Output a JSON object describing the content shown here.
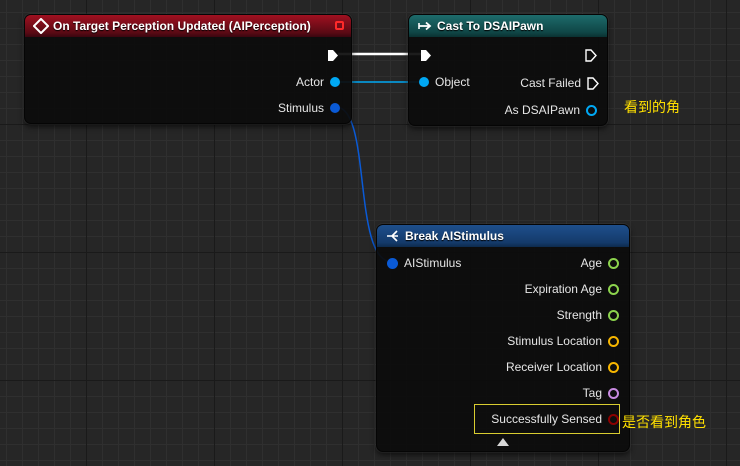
{
  "colors": {
    "object_pin": "#00a8f4",
    "struct_pin": "#0a5ad6",
    "float_pin": "#8cd34d",
    "vector_pin": "#f7b600",
    "name_pin": "#c78ae0",
    "bool_pin": "#8b0000",
    "exec_pin": "#ffffff",
    "annotation": "#ffe000"
  },
  "event_node": {
    "title": "On Target Perception Updated (AIPerception)",
    "icon": "event-diamond-icon",
    "pins": {
      "actor": "Actor",
      "stimulus": "Stimulus"
    }
  },
  "cast_node": {
    "title": "Cast To DSAIPawn",
    "icon": "cast-arrow-icon",
    "pins": {
      "object": "Object",
      "cast_failed": "Cast Failed",
      "as_pawn": "As DSAIPawn"
    }
  },
  "break_node": {
    "title": "Break AIStimulus",
    "icon": "break-struct-icon",
    "pins": {
      "input": "AIStimulus",
      "age": "Age",
      "expiration_age": "Expiration Age",
      "strength": "Strength",
      "stimulus_location": "Stimulus Location",
      "receiver_location": "Receiver Location",
      "tag": "Tag",
      "successfully_sensed": "Successfully Sensed"
    }
  },
  "annotations": {
    "seen_character": "看到的角",
    "sensed_character": "是否看到角色"
  }
}
